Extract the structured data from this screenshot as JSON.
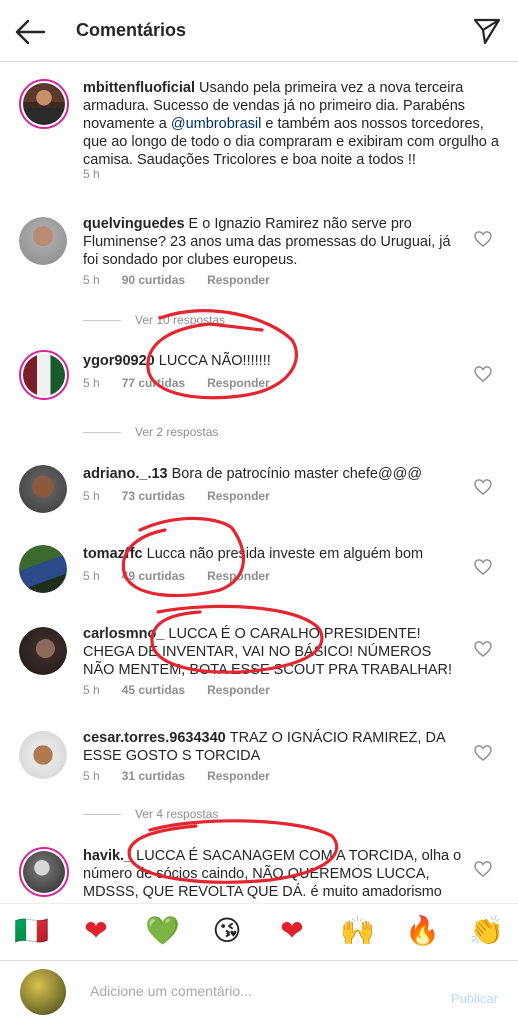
{
  "header": {
    "title": "Comentários"
  },
  "caption": {
    "username": "mbittenfluoficial",
    "text_before": "Usando pela primeira vez a nova terceira armadura. Sucesso de vendas já no primeiro dia. Parabéns novamente a ",
    "mention": "@umbrobrasil",
    "text_after": " e também aos nossos torcedores, que ao longo de todo o dia compraram e exibiram com orgulho a camisa. Saudações Tricolores e boa noite a todos !!",
    "time": "5 h"
  },
  "comments": [
    {
      "username": "quelvinguedes",
      "text": "E o Ignazio Ramirez não serve pro Fluminense? 23 anos uma das promessas do Uruguai, já foi sondado por clubes europeus.",
      "time": "5 h",
      "likes": "90 curtidas",
      "reply": "Responder",
      "view_replies": "Ver 10 respostas"
    },
    {
      "username": "ygor90920",
      "text": "LUCCA NÃO!!!!!!!",
      "time": "5 h",
      "likes": "77 curtidas",
      "reply": "Responder",
      "view_replies": "Ver 2 respostas"
    },
    {
      "username": "adriano._.13",
      "text": "Bora de patrocínio master chefe@@@",
      "time": "5 h",
      "likes": "73 curtidas",
      "reply": "Responder"
    },
    {
      "username": "tomazffc",
      "text": "Lucca não presida investe em alguém bom",
      "time": "5 h",
      "likes": "49 curtidas",
      "reply": "Responder"
    },
    {
      "username": "carlosmno_",
      "text": "LUCCA É O CARALHO PRESIDENTE! CHEGA DE INVENTAR, VAI NO BÁSICO! NÚMEROS NÃO MENTEM, BOTA ESSE SCOUT PRA TRABALHAR!",
      "time": "5 h",
      "likes": "45 curtidas",
      "reply": "Responder"
    },
    {
      "username": "cesar.torres.9634340",
      "text": "TRAZ O IGNÁCIO RAMIREZ, DA ESSE GOSTO S TORCIDA",
      "time": "5 h",
      "likes": "31 curtidas",
      "reply": "Responder",
      "view_replies": "Ver 4 respostas"
    },
    {
      "username": "havik._",
      "text": "LUCCA É SACANAGEM COM A TORCIDA, olha o número de sócios caindo, NÃO QUEREMOS LUCCA, MDSSS, QUE REVOLTA QUE DÁ. é muito amadorismo pra uma gestão só"
    }
  ],
  "emojis": [
    "🇮🇹",
    "❤",
    "💚",
    "😘",
    "❤",
    "🙌",
    "🔥",
    "👏"
  ],
  "comment_box": {
    "placeholder": "Adicione um comentário...",
    "publish_label": "Publicar"
  },
  "colors": {
    "annotation_red": "#e3262f",
    "mention": "#003569",
    "publish": "#b3dbff"
  }
}
